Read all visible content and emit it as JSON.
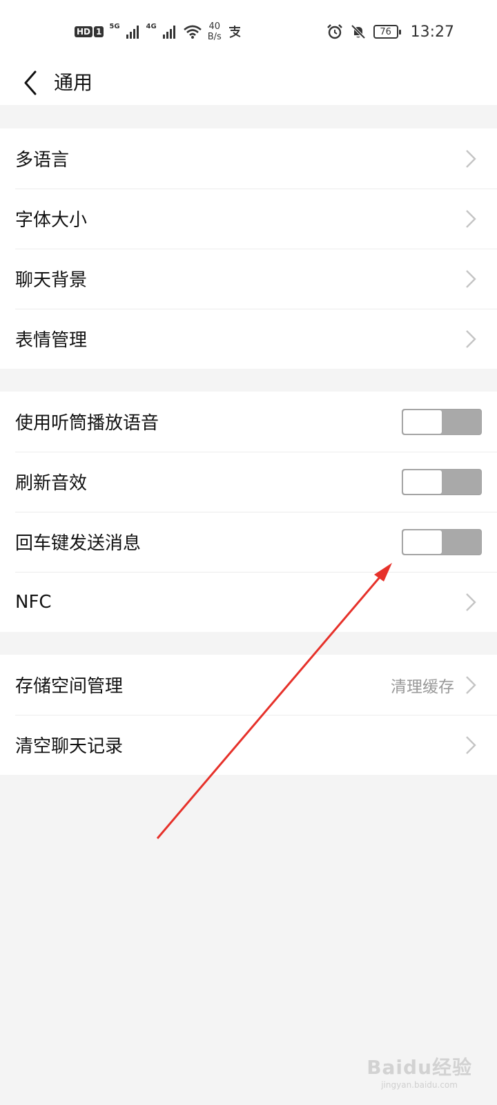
{
  "statusbar": {
    "hd_label": "HD",
    "sim_label": "1",
    "net1": "5G",
    "net2": "4G",
    "speed_value": "40",
    "speed_unit": "B/s",
    "battery": "76",
    "time": "13:27"
  },
  "header": {
    "title": "通用"
  },
  "group1": {
    "items": [
      {
        "label": "多语言"
      },
      {
        "label": "字体大小"
      },
      {
        "label": "聊天背景"
      },
      {
        "label": "表情管理"
      }
    ]
  },
  "group2": {
    "items": [
      {
        "label": "使用听筒播放语音",
        "state": "off"
      },
      {
        "label": "刷新音效",
        "state": "off"
      },
      {
        "label": "回车键发送消息",
        "state": "off"
      },
      {
        "label": "NFC"
      }
    ]
  },
  "group3": {
    "items": [
      {
        "label": "存储空间管理",
        "value": "清理缓存"
      },
      {
        "label": "清空聊天记录"
      }
    ]
  },
  "watermark": {
    "logo": "Baidu经验",
    "url": "jingyan.baidu.com"
  },
  "colors": {
    "arrow": "#e6312a",
    "toggle_track": "#a9a9a9",
    "chevron": "#c4c4c4"
  }
}
